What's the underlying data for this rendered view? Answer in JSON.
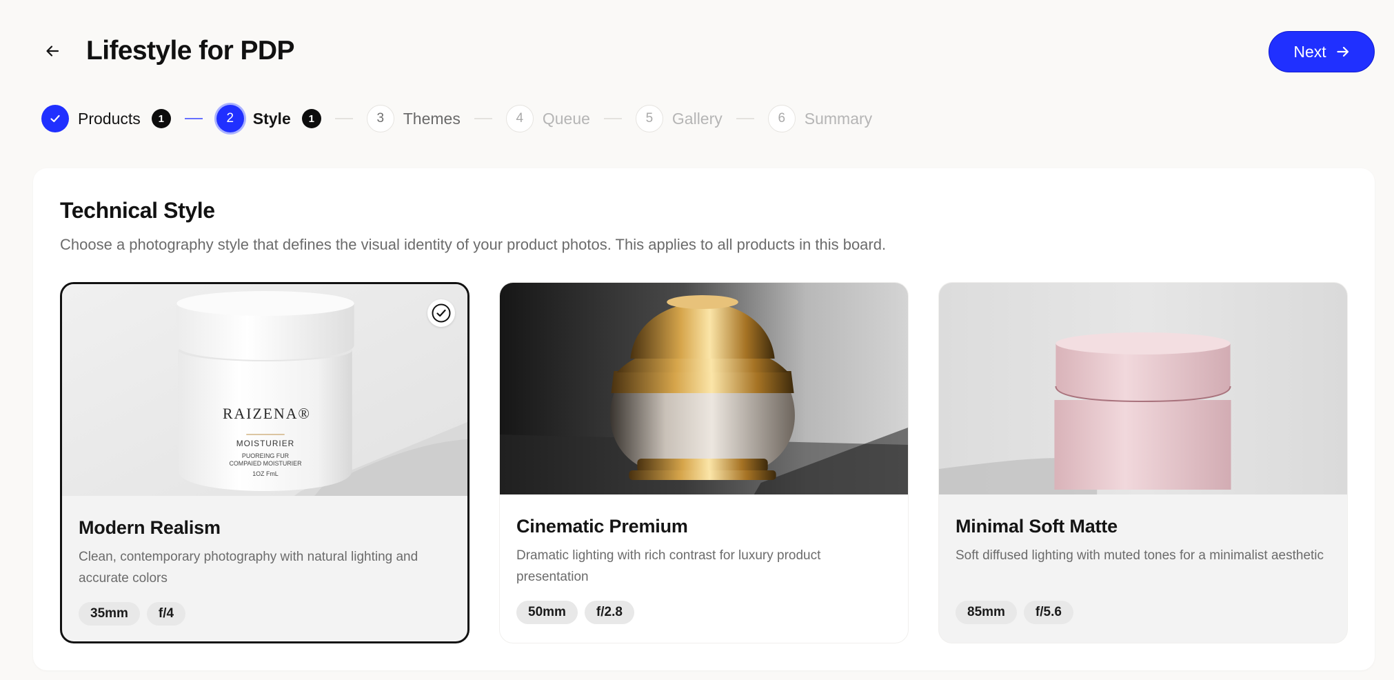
{
  "header": {
    "title": "Lifestyle for PDP",
    "back_icon": "arrow-left-icon",
    "next_label": "Next",
    "next_icon": "arrow-right-icon",
    "accent_color": "#2030ff"
  },
  "stepper": {
    "steps": [
      {
        "number": "1",
        "label": "Products",
        "state": "done",
        "badge": "1"
      },
      {
        "number": "2",
        "label": "Style",
        "state": "active",
        "badge": "1"
      },
      {
        "number": "3",
        "label": "Themes",
        "state": "upcoming"
      },
      {
        "number": "4",
        "label": "Queue",
        "state": "disabled"
      },
      {
        "number": "5",
        "label": "Gallery",
        "state": "disabled"
      },
      {
        "number": "6",
        "label": "Summary",
        "state": "disabled"
      }
    ]
  },
  "section": {
    "title": "Technical Style",
    "description": "Choose a photography style that defines the visual identity of your product photos. This applies to all products in this board."
  },
  "styles": [
    {
      "title": "Modern Realism",
      "description": "Clean, contemporary photography with natural lighting and accurate colors",
      "lens": "35mm",
      "aperture": "f/4",
      "selected": true,
      "image_text": {
        "brand": "RAIZENA®",
        "product": "MOISTURIER",
        "line1": "PUOREING FUR",
        "line2": "COMPAIED MOISTURIER",
        "size": "1OZ FmL"
      }
    },
    {
      "title": "Cinematic Premium",
      "description": "Dramatic lighting with rich contrast for luxury product presentation",
      "lens": "50mm",
      "aperture": "f/2.8",
      "selected": false
    },
    {
      "title": "Minimal Soft Matte",
      "description": "Soft diffused lighting with muted tones for a minimalist aesthetic",
      "lens": "85mm",
      "aperture": "f/5.6",
      "selected": false
    }
  ]
}
